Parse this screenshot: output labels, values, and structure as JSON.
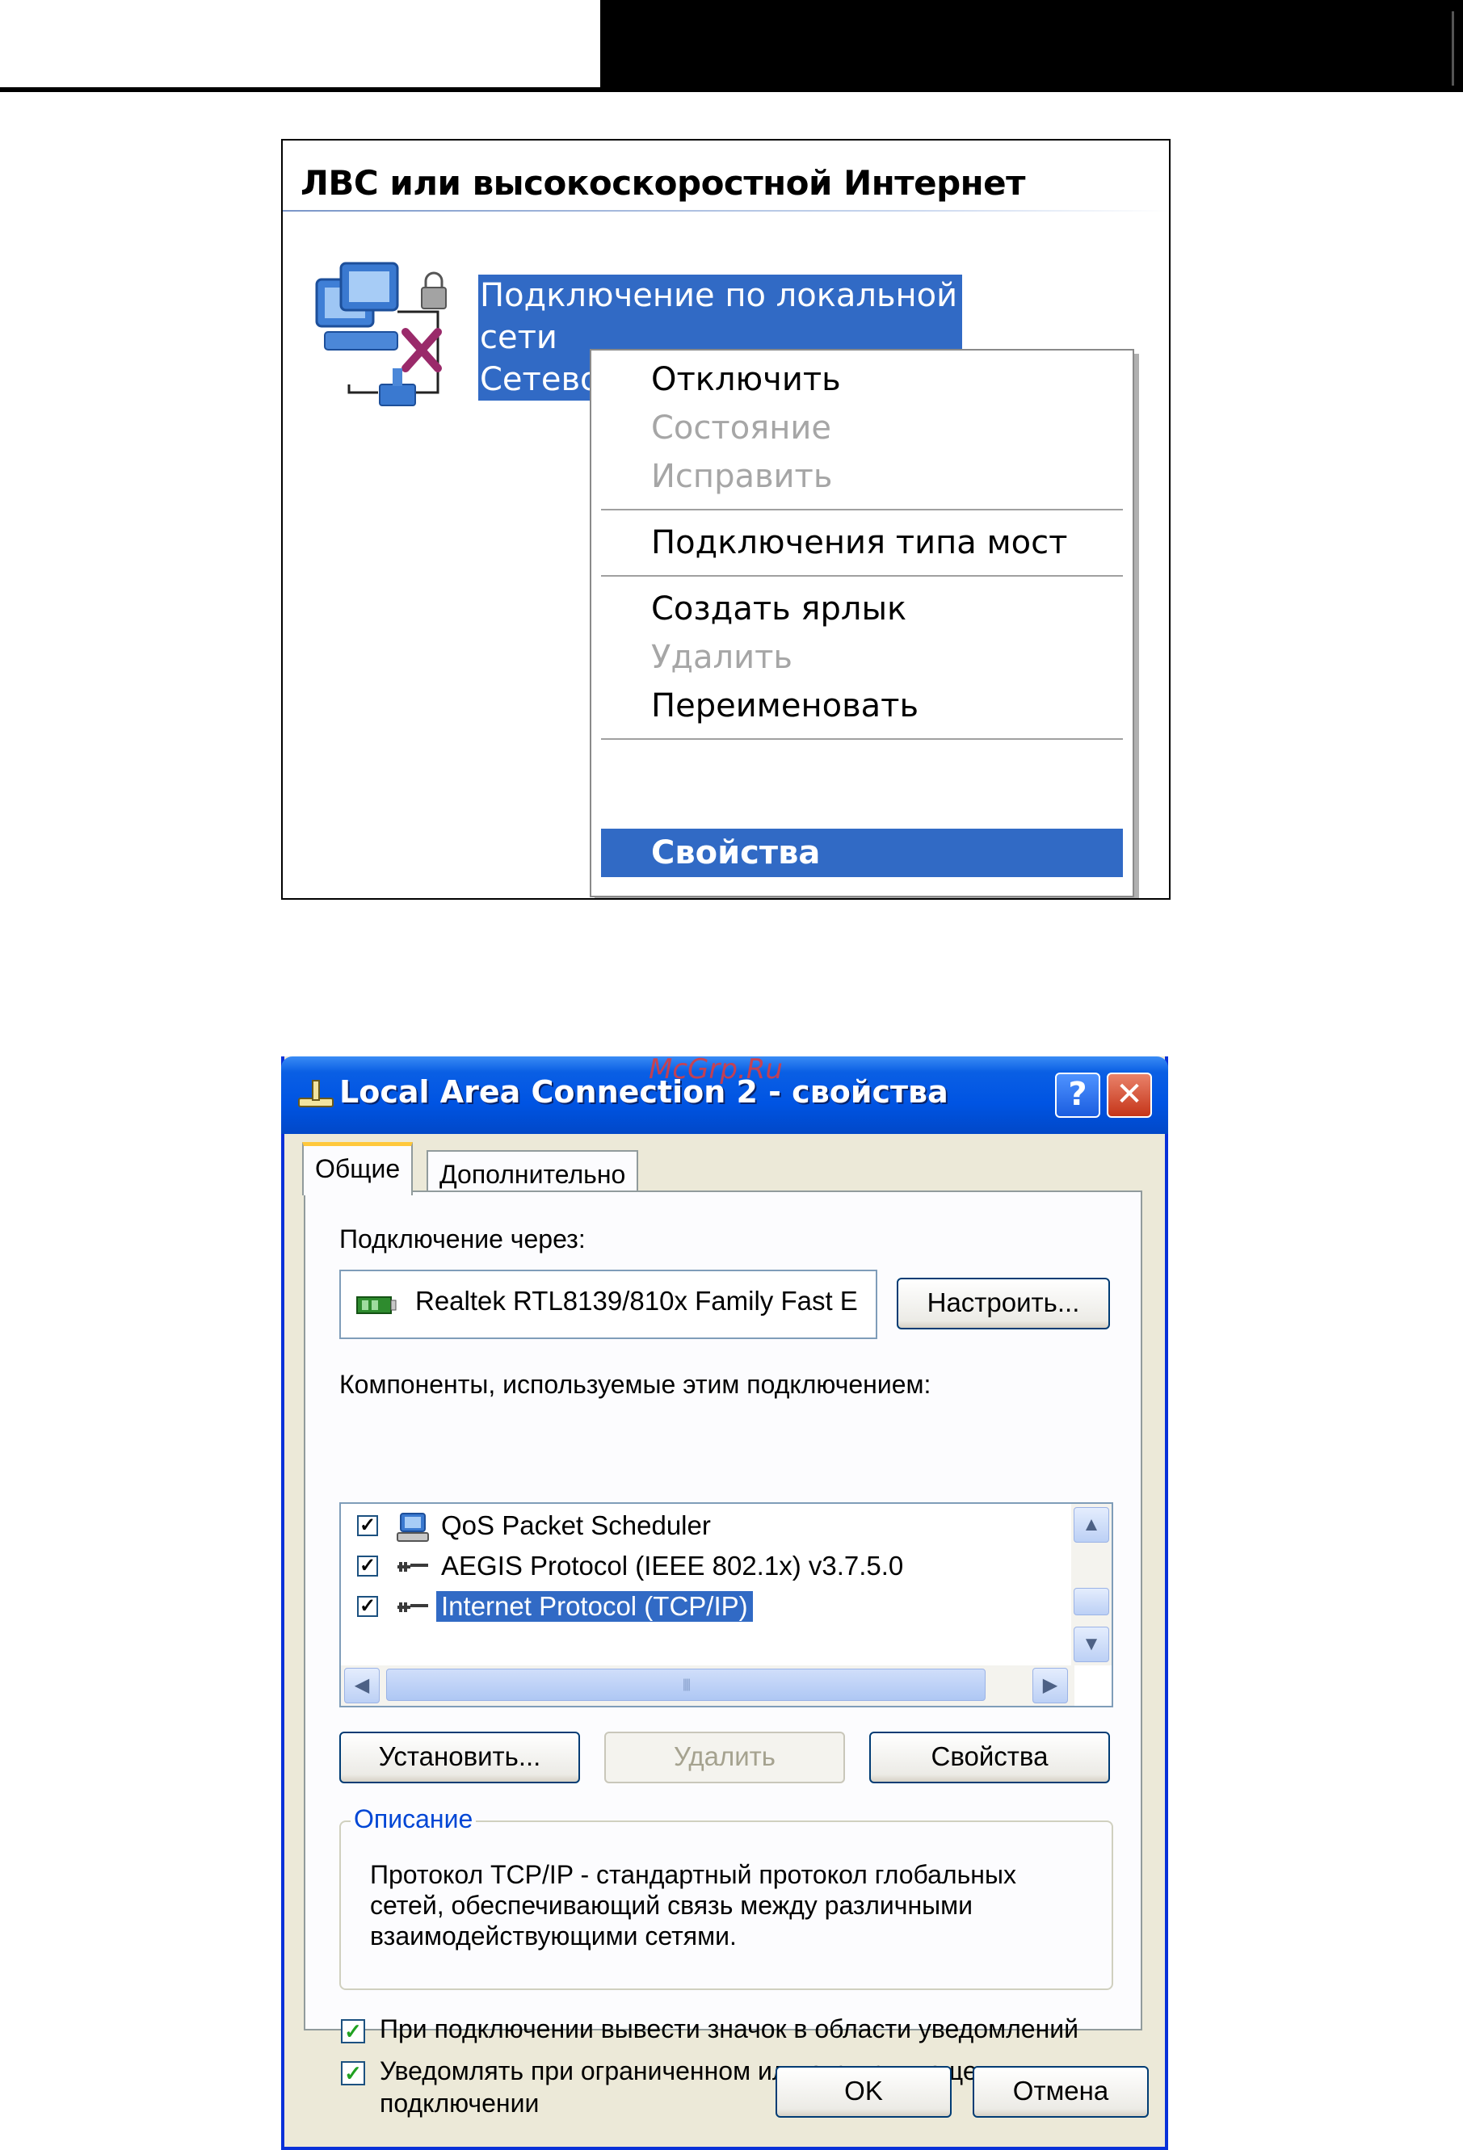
{
  "screenshot1": {
    "section_title": "ЛВС или высокоскоростной Интернет",
    "connection": {
      "name_line1": "Подключение по локальной",
      "name_line2": "сети",
      "status_line": "Сетево"
    },
    "context_menu": {
      "items": [
        {
          "label": "Отключить",
          "state": "enabled"
        },
        {
          "label": "Состояние",
          "state": "disabled"
        },
        {
          "label": "Исправить",
          "state": "disabled"
        },
        {
          "label": "Подключения типа мост",
          "state": "enabled"
        },
        {
          "label": "Создать ярлык",
          "state": "enabled"
        },
        {
          "label": "Удалить",
          "state": "disabled"
        },
        {
          "label": "Переименовать",
          "state": "enabled"
        },
        {
          "label": "Свойства",
          "state": "selected"
        }
      ]
    }
  },
  "dialog": {
    "title": "Local Area Connection 2 - свойства",
    "watermark": "McGrp.Ru",
    "help_button": "?",
    "close_button": "✕",
    "tabs": [
      "Общие",
      "Дополнительно"
    ],
    "active_tab": "Общие",
    "connect_using_label": "Подключение через:",
    "adapter_name": "Realtek RTL8139/810x Family Fast E",
    "configure_button": "Настроить...",
    "components_label": "Компоненты, используемые этим подключением:",
    "components": [
      {
        "name": "QoS Packet Scheduler",
        "checked": true,
        "selected": false,
        "icon": "qos-scheduler-icon"
      },
      {
        "name": "AEGIS Protocol (IEEE 802.1x) v3.7.5.0",
        "checked": true,
        "selected": false,
        "icon": "protocol-icon"
      },
      {
        "name": "Internet Protocol (TCP/IP)",
        "checked": true,
        "selected": true,
        "icon": "protocol-icon"
      }
    ],
    "install_button": "Установить...",
    "uninstall_button": "Удалить",
    "properties_button": "Свойства",
    "description_legend": "Описание",
    "description_lines": [
      "Протокол TCP/IP - стандартный протокол глобальных",
      "сетей, обеспечивающий связь между различными",
      "взаимодействующими сетями."
    ],
    "show_icon_option": {
      "label": "При подключении вывести значок в области уведомлений",
      "checked": true
    },
    "notify_option": {
      "label_line1": "Уведомлять при ограниченном или отсутствующем",
      "label_line2": "подключении",
      "checked": true
    },
    "ok_button": "OK",
    "cancel_button": "Отмена"
  },
  "colors": {
    "selection_blue": "#316ac5",
    "xp_titlebar": "#0054e3",
    "dialog_face": "#ece9d8",
    "disabled_text": "#a6a6a6",
    "checkbox_green": "#21a121"
  }
}
